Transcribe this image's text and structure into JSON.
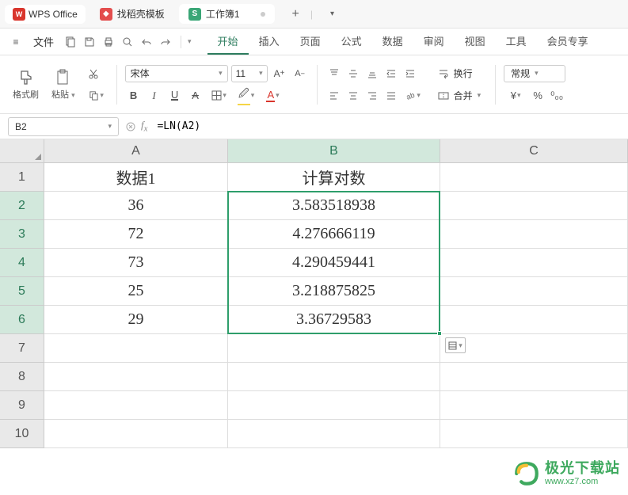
{
  "app": {
    "name": "WPS Office"
  },
  "tabs": {
    "template": "找稻壳模板",
    "workbook": "工作簿1",
    "add": "+"
  },
  "menu": {
    "file": "文件",
    "ribbon": [
      "开始",
      "插入",
      "页面",
      "公式",
      "数据",
      "审阅",
      "视图",
      "工具",
      "会员专享"
    ]
  },
  "toolbar": {
    "format_painter": "格式刷",
    "paste": "粘贴",
    "font_name": "宋体",
    "font_size": "11",
    "wrap": "换行",
    "merge": "合并",
    "number_format": "常规"
  },
  "formula_bar": {
    "cell_ref": "B2",
    "formula": "=LN(A2)"
  },
  "sheet": {
    "columns": [
      "A",
      "B",
      "C"
    ],
    "headers": {
      "A": "数据1",
      "B": "计算对数"
    },
    "rows": [
      {
        "n": "1"
      },
      {
        "n": "2",
        "A": "36",
        "B": "3.583518938"
      },
      {
        "n": "3",
        "A": "72",
        "B": "4.276666119"
      },
      {
        "n": "4",
        "A": "73",
        "B": "4.290459441"
      },
      {
        "n": "5",
        "A": "25",
        "B": "3.218875825"
      },
      {
        "n": "6",
        "A": "29",
        "B": "3.36729583"
      },
      {
        "n": "7"
      },
      {
        "n": "8"
      },
      {
        "n": "9"
      },
      {
        "n": "10"
      }
    ]
  },
  "watermark": {
    "cn": "极光下载站",
    "url": "www.xz7.com"
  }
}
